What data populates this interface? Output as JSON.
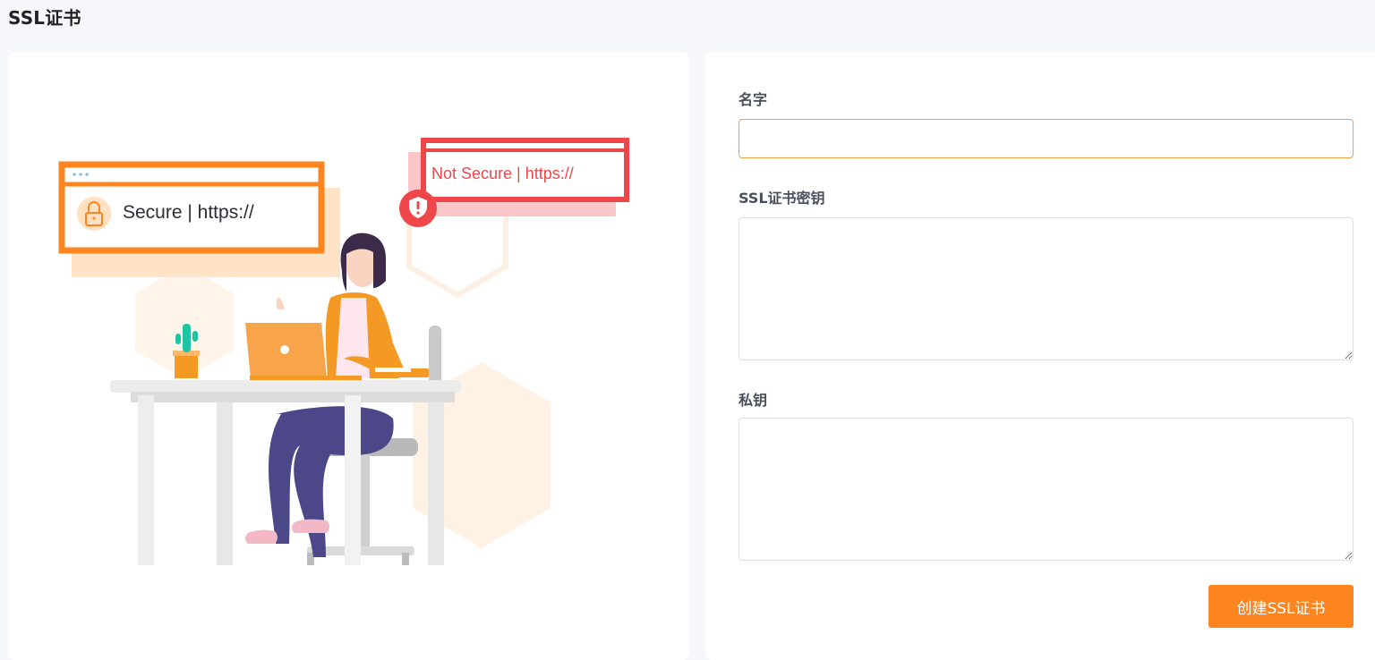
{
  "page": {
    "title": "SSL证书"
  },
  "illustration": {
    "secure_label": "Secure | https://",
    "not_secure_label": "Not Secure | https://"
  },
  "form": {
    "name_label": "名字",
    "name_value": "",
    "cert_key_label": "SSL证书密钥",
    "cert_key_value": "",
    "private_key_label": "私钥",
    "private_key_value": "",
    "submit_label": "创建SSL证书"
  },
  "colors": {
    "accent": "#fc851f",
    "danger": "#ef4649",
    "background": "#f6f7fb"
  }
}
